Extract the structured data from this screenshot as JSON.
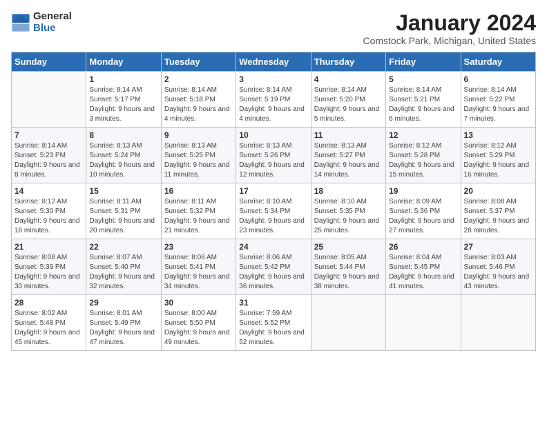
{
  "logo": {
    "general": "General",
    "blue": "Blue"
  },
  "title": "January 2024",
  "location": "Comstock Park, Michigan, United States",
  "days_of_week": [
    "Sunday",
    "Monday",
    "Tuesday",
    "Wednesday",
    "Thursday",
    "Friday",
    "Saturday"
  ],
  "weeks": [
    [
      {
        "day": "",
        "sunrise": "",
        "sunset": "",
        "daylight": ""
      },
      {
        "day": "1",
        "sunrise": "Sunrise: 8:14 AM",
        "sunset": "Sunset: 5:17 PM",
        "daylight": "Daylight: 9 hours and 3 minutes."
      },
      {
        "day": "2",
        "sunrise": "Sunrise: 8:14 AM",
        "sunset": "Sunset: 5:18 PM",
        "daylight": "Daylight: 9 hours and 4 minutes."
      },
      {
        "day": "3",
        "sunrise": "Sunrise: 8:14 AM",
        "sunset": "Sunset: 5:19 PM",
        "daylight": "Daylight: 9 hours and 4 minutes."
      },
      {
        "day": "4",
        "sunrise": "Sunrise: 8:14 AM",
        "sunset": "Sunset: 5:20 PM",
        "daylight": "Daylight: 9 hours and 5 minutes."
      },
      {
        "day": "5",
        "sunrise": "Sunrise: 8:14 AM",
        "sunset": "Sunset: 5:21 PM",
        "daylight": "Daylight: 9 hours and 6 minutes."
      },
      {
        "day": "6",
        "sunrise": "Sunrise: 8:14 AM",
        "sunset": "Sunset: 5:22 PM",
        "daylight": "Daylight: 9 hours and 7 minutes."
      }
    ],
    [
      {
        "day": "7",
        "sunrise": "Sunrise: 8:14 AM",
        "sunset": "Sunset: 5:23 PM",
        "daylight": "Daylight: 9 hours and 8 minutes."
      },
      {
        "day": "8",
        "sunrise": "Sunrise: 8:13 AM",
        "sunset": "Sunset: 5:24 PM",
        "daylight": "Daylight: 9 hours and 10 minutes."
      },
      {
        "day": "9",
        "sunrise": "Sunrise: 8:13 AM",
        "sunset": "Sunset: 5:25 PM",
        "daylight": "Daylight: 9 hours and 11 minutes."
      },
      {
        "day": "10",
        "sunrise": "Sunrise: 8:13 AM",
        "sunset": "Sunset: 5:26 PM",
        "daylight": "Daylight: 9 hours and 12 minutes."
      },
      {
        "day": "11",
        "sunrise": "Sunrise: 8:13 AM",
        "sunset": "Sunset: 5:27 PM",
        "daylight": "Daylight: 9 hours and 14 minutes."
      },
      {
        "day": "12",
        "sunrise": "Sunrise: 8:12 AM",
        "sunset": "Sunset: 5:28 PM",
        "daylight": "Daylight: 9 hours and 15 minutes."
      },
      {
        "day": "13",
        "sunrise": "Sunrise: 8:12 AM",
        "sunset": "Sunset: 5:29 PM",
        "daylight": "Daylight: 9 hours and 16 minutes."
      }
    ],
    [
      {
        "day": "14",
        "sunrise": "Sunrise: 8:12 AM",
        "sunset": "Sunset: 5:30 PM",
        "daylight": "Daylight: 9 hours and 18 minutes."
      },
      {
        "day": "15",
        "sunrise": "Sunrise: 8:11 AM",
        "sunset": "Sunset: 5:31 PM",
        "daylight": "Daylight: 9 hours and 20 minutes."
      },
      {
        "day": "16",
        "sunrise": "Sunrise: 8:11 AM",
        "sunset": "Sunset: 5:32 PM",
        "daylight": "Daylight: 9 hours and 21 minutes."
      },
      {
        "day": "17",
        "sunrise": "Sunrise: 8:10 AM",
        "sunset": "Sunset: 5:34 PM",
        "daylight": "Daylight: 9 hours and 23 minutes."
      },
      {
        "day": "18",
        "sunrise": "Sunrise: 8:10 AM",
        "sunset": "Sunset: 5:35 PM",
        "daylight": "Daylight: 9 hours and 25 minutes."
      },
      {
        "day": "19",
        "sunrise": "Sunrise: 8:09 AM",
        "sunset": "Sunset: 5:36 PM",
        "daylight": "Daylight: 9 hours and 27 minutes."
      },
      {
        "day": "20",
        "sunrise": "Sunrise: 8:08 AM",
        "sunset": "Sunset: 5:37 PM",
        "daylight": "Daylight: 9 hours and 28 minutes."
      }
    ],
    [
      {
        "day": "21",
        "sunrise": "Sunrise: 8:08 AM",
        "sunset": "Sunset: 5:39 PM",
        "daylight": "Daylight: 9 hours and 30 minutes."
      },
      {
        "day": "22",
        "sunrise": "Sunrise: 8:07 AM",
        "sunset": "Sunset: 5:40 PM",
        "daylight": "Daylight: 9 hours and 32 minutes."
      },
      {
        "day": "23",
        "sunrise": "Sunrise: 8:06 AM",
        "sunset": "Sunset: 5:41 PM",
        "daylight": "Daylight: 9 hours and 34 minutes."
      },
      {
        "day": "24",
        "sunrise": "Sunrise: 8:06 AM",
        "sunset": "Sunset: 5:42 PM",
        "daylight": "Daylight: 9 hours and 36 minutes."
      },
      {
        "day": "25",
        "sunrise": "Sunrise: 8:05 AM",
        "sunset": "Sunset: 5:44 PM",
        "daylight": "Daylight: 9 hours and 38 minutes."
      },
      {
        "day": "26",
        "sunrise": "Sunrise: 8:04 AM",
        "sunset": "Sunset: 5:45 PM",
        "daylight": "Daylight: 9 hours and 41 minutes."
      },
      {
        "day": "27",
        "sunrise": "Sunrise: 8:03 AM",
        "sunset": "Sunset: 5:46 PM",
        "daylight": "Daylight: 9 hours and 43 minutes."
      }
    ],
    [
      {
        "day": "28",
        "sunrise": "Sunrise: 8:02 AM",
        "sunset": "Sunset: 5:48 PM",
        "daylight": "Daylight: 9 hours and 45 minutes."
      },
      {
        "day": "29",
        "sunrise": "Sunrise: 8:01 AM",
        "sunset": "Sunset: 5:49 PM",
        "daylight": "Daylight: 9 hours and 47 minutes."
      },
      {
        "day": "30",
        "sunrise": "Sunrise: 8:00 AM",
        "sunset": "Sunset: 5:50 PM",
        "daylight": "Daylight: 9 hours and 49 minutes."
      },
      {
        "day": "31",
        "sunrise": "Sunrise: 7:59 AM",
        "sunset": "Sunset: 5:52 PM",
        "daylight": "Daylight: 9 hours and 52 minutes."
      },
      {
        "day": "",
        "sunrise": "",
        "sunset": "",
        "daylight": ""
      },
      {
        "day": "",
        "sunrise": "",
        "sunset": "",
        "daylight": ""
      },
      {
        "day": "",
        "sunrise": "",
        "sunset": "",
        "daylight": ""
      }
    ]
  ]
}
